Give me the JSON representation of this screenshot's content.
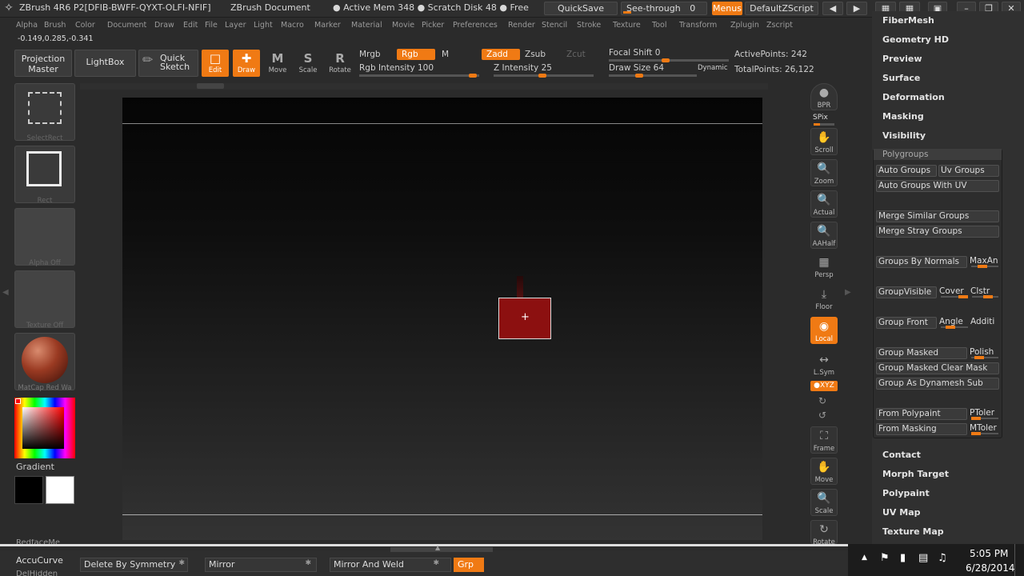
{
  "title_bar": {
    "app": "ZBrush 4R6 P2[DFIB-BWFF-QYXT-OLFI-NFIF]",
    "doc": "ZBrush Document",
    "mem": "● Active Mem 348 ● Scratch Disk 48 ● Free",
    "quicksave": "QuickSave",
    "see_through": "See-through",
    "see_through_val": "0",
    "menus": "Menus",
    "default_script": "DefaultZScript"
  },
  "menu": [
    "Alpha",
    "Brush",
    "Color",
    "Document",
    "Draw",
    "Edit",
    "File",
    "Layer",
    "Light",
    "Macro",
    "Marker",
    "Material",
    "Movie",
    "Picker",
    "Preferences",
    "Render",
    "Stencil",
    "Stroke",
    "Texture",
    "Tool",
    "Transform",
    "Zplugin",
    "Zscript"
  ],
  "coords": "-0.149,0.285,-0.341",
  "toolbar": {
    "projection": "Projection Master",
    "lightbox": "LightBox",
    "quick_sketch": "Quick Sketch",
    "edit": "Edit",
    "draw": "Draw",
    "move": "Move",
    "scale": "Scale",
    "rotate": "Rotate",
    "mrgb": "Mrgb",
    "rgb": "Rgb",
    "m": "M",
    "zadd": "Zadd",
    "zsub": "Zsub",
    "zcut": "Zcut",
    "rgb_intensity": "Rgb Intensity 100",
    "rgb_intensity_value": 100,
    "z_intensity": "Z Intensity 25",
    "z_intensity_value": 25,
    "focal_shift": "Focal Shift 0",
    "focal_shift_value": 0,
    "draw_size": "Draw Size 64",
    "draw_size_value": 64,
    "dynamic": "Dynamic",
    "active_points": "ActivePoints: 242",
    "total_points": "TotalPoints: 26,122"
  },
  "left": {
    "select_rect": "SelectRect",
    "rect": "Rect",
    "alpha_off": "Alpha Off",
    "texture_off": "Texture Off",
    "matcap": "MatCap Red Wa",
    "gradient": "Gradient"
  },
  "right_shelf": {
    "bpr": "BPR",
    "spix": "SPix",
    "scroll": "Scroll",
    "zoom": "Zoom",
    "actual": "Actual",
    "aahalf": "AAHalf",
    "persp": "Persp",
    "floor": "Floor",
    "local": "Local",
    "lsym": "L.Sym",
    "xyz": "●XYZ",
    "frame": "Frame",
    "move": "Move",
    "scale": "Scale",
    "rotate": "Rotate"
  },
  "panel": {
    "top_items": [
      "FiberMesh",
      "Geometry HD",
      "Preview",
      "Surface",
      "Deformation",
      "Masking",
      "Visibility"
    ],
    "polygroups": "Polygroups",
    "auto_groups": "Auto Groups",
    "uv_groups": "Uv Groups",
    "auto_groups_uv": "Auto Groups With UV",
    "merge_similar": "Merge Similar Groups",
    "merge_stray": "Merge Stray Groups",
    "groups_by_normals": "Groups By Normals",
    "maxan": "MaxAn",
    "groupvisible": "GroupVisible",
    "cover": "Cover",
    "clstr": "Clstr",
    "group_front": "Group Front",
    "angle": "Angle",
    "additi": "Additi",
    "group_masked": "Group Masked",
    "polish": "Polish",
    "group_masked_clear": "Group Masked Clear Mask",
    "group_as_dynamesh": "Group As Dynamesh Sub",
    "from_polypaint": "From Polypaint",
    "ptoler": "PToler",
    "from_masking": "From Masking",
    "mtoler": "MToler",
    "bottom_items": [
      "Contact",
      "Morph Target",
      "Polypaint",
      "UV Map",
      "Texture Map"
    ]
  },
  "bottom": {
    "cut_label": "RedfaceMe",
    "accucurve": "AccuCurve",
    "dellhidden": "DelHidden",
    "delete_by_symmetry": "Delete By Symmetry",
    "mirror": "Mirror",
    "mirror_and_weld": "Mirror And Weld",
    "grp": "Grp"
  },
  "taskbar": {
    "time": "5:05 PM",
    "date": "6/28/2014"
  }
}
